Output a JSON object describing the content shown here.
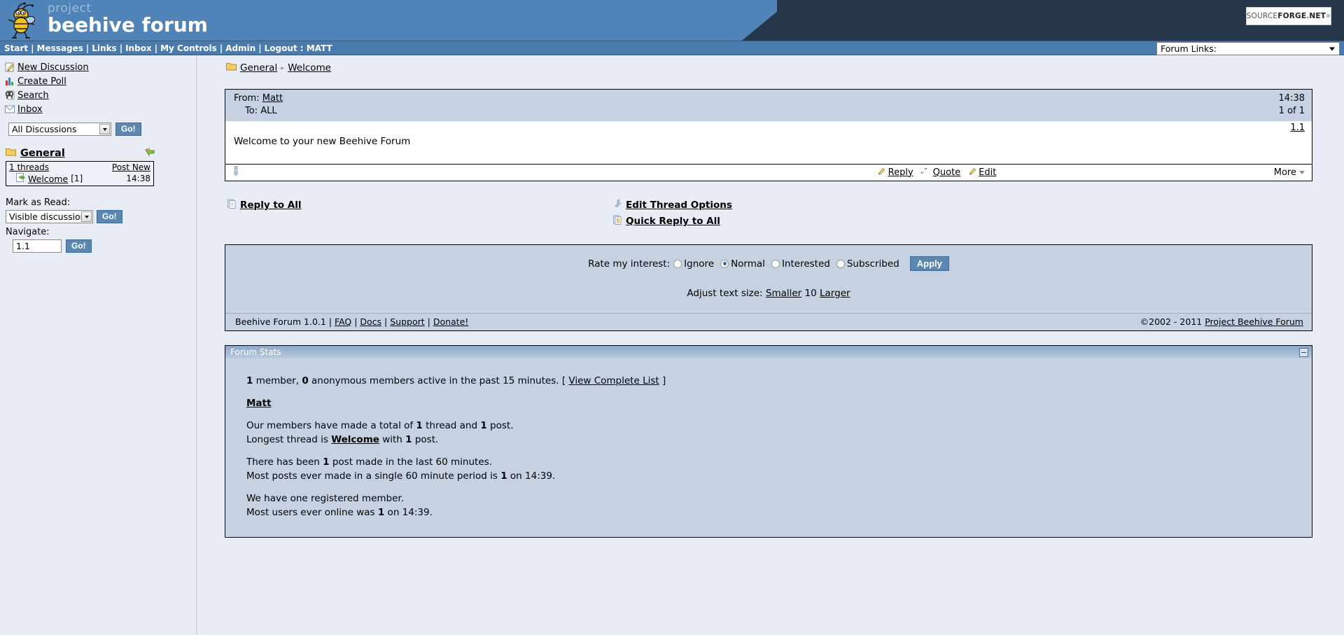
{
  "header": {
    "brand_small": "project",
    "brand_main": "beehive forum",
    "sourceforge": {
      "part1": "SOURCE",
      "part2": "FORGE",
      "dot": ".",
      "part3": "NET",
      "sup": "®"
    }
  },
  "nav": {
    "items": [
      "Start",
      "Messages",
      "Links",
      "Inbox",
      "My Controls",
      "Admin"
    ],
    "logout": "Logout : MATT",
    "forum_links_label": "Forum Links:"
  },
  "sidebar": {
    "links": [
      {
        "label": "New Discussion",
        "icon": "new-discussion-icon"
      },
      {
        "label": "Create Poll",
        "icon": "create-poll-icon"
      },
      {
        "label": "Search",
        "icon": "search-icon"
      },
      {
        "label": "Inbox",
        "icon": "inbox-icon"
      }
    ],
    "discussion_filter": "All Discussions",
    "go_label": "Go!",
    "folder_name": "General",
    "threads_count_label": "1 threads",
    "post_new_label": "Post New",
    "thread": {
      "name": "Welcome",
      "count": "[1]",
      "time": "14:38"
    },
    "mark_as_read_label": "Mark as Read:",
    "mark_as_read_value": "Visible discussions",
    "mark_go_label": "Go!",
    "navigate_label": "Navigate:",
    "navigate_value": "1.1",
    "navigate_go_label": "Go!"
  },
  "breadcrumb": {
    "folder": "General",
    "separator": "▸",
    "thread": "Welcome"
  },
  "message": {
    "from_label": "From:",
    "from_value": "Matt",
    "to_label": "To:",
    "to_value": "ALL",
    "time": "14:38",
    "position": "1 of 1",
    "permalink": "1.1",
    "body": "Welcome to your new Beehive Forum",
    "actions": [
      {
        "label": "Reply",
        "icon": "reply-pencil-icon"
      },
      {
        "label": "Quote",
        "icon": "quote-icon"
      },
      {
        "label": "Edit",
        "icon": "edit-pencil-icon"
      }
    ],
    "more_label": "More"
  },
  "thread_actions": {
    "reply_to_all": "Reply to All",
    "edit_thread_options": "Edit Thread Options",
    "quick_reply_to_all": "Quick Reply to All"
  },
  "options": {
    "rate_label": "Rate my interest:",
    "ratings": [
      {
        "label": "Ignore",
        "selected": false
      },
      {
        "label": "Normal",
        "selected": true
      },
      {
        "label": "Interested",
        "selected": false
      },
      {
        "label": "Subscribed",
        "selected": false
      }
    ],
    "apply_label": "Apply",
    "text_size_label": "Adjust text size:",
    "smaller_label": "Smaller",
    "size_value": "10",
    "larger_label": "Larger",
    "footer_version": "Beehive Forum 1.0.1 |",
    "footer_links": [
      "FAQ",
      "Docs",
      "Support",
      "Donate!"
    ],
    "copyright_prefix": "©2002 - 2011 ",
    "copyright_link": "Project Beehive Forum"
  },
  "stats": {
    "title": "Forum Stats",
    "active_count": "1",
    "active_text_1": " member, ",
    "anon_count": "0",
    "active_text_2": " anonymous members active in the past 15 minutes. [ ",
    "view_list_label": "View Complete List",
    "active_text_3": " ]",
    "member_name": "Matt",
    "total_prefix": "Our members have made a total of ",
    "total_threads": "1",
    "total_mid": " thread and ",
    "total_posts": "1",
    "total_suffix": " post.",
    "longest_prefix": "Longest thread is ",
    "longest_thread": "Welcome",
    "longest_mid": " with ",
    "longest_posts": "1",
    "longest_suffix": " post.",
    "recent_prefix": "There has been ",
    "recent_count": "1",
    "recent_suffix": " post made in the last 60 minutes.",
    "mostposts_prefix": "Most posts ever made in a single 60 minute period is ",
    "mostposts_count": "1",
    "mostposts_mid": " on ",
    "mostposts_time": "14:39.",
    "registered_line": "We have one registered member.",
    "mostusers_prefix": "Most users ever online was ",
    "mostusers_count": "1",
    "mostusers_mid": " on ",
    "mostusers_time": "14:39."
  }
}
